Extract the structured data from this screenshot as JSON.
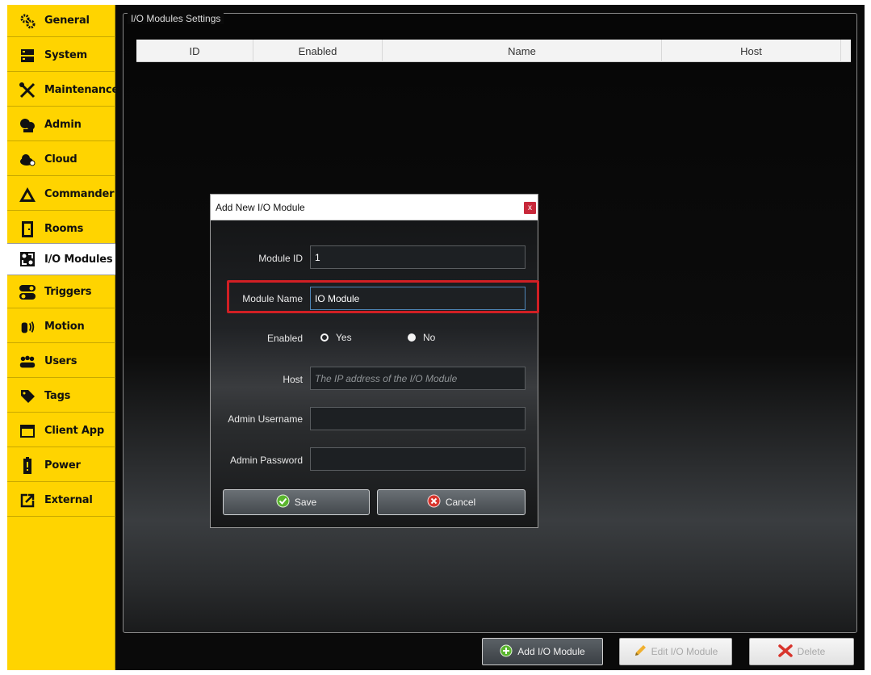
{
  "sidebar": {
    "items": [
      {
        "label": "General",
        "icon": "gears-icon"
      },
      {
        "label": "System",
        "icon": "server-icon"
      },
      {
        "label": "Maintenance",
        "icon": "tools-icon"
      },
      {
        "label": "Admin",
        "icon": "admin-icon"
      },
      {
        "label": "Cloud",
        "icon": "cloud-icon"
      },
      {
        "label": "Commander",
        "icon": "commander-icon"
      },
      {
        "label": "Rooms",
        "icon": "door-icon"
      },
      {
        "label": "I/O Modules",
        "icon": "io-module-icon",
        "active": true
      },
      {
        "label": "Triggers",
        "icon": "toggle-icon"
      },
      {
        "label": "Motion",
        "icon": "motion-hand-icon"
      },
      {
        "label": "Users",
        "icon": "users-icon"
      },
      {
        "label": "Tags",
        "icon": "tag-icon"
      },
      {
        "label": "Client App",
        "icon": "window-icon"
      },
      {
        "label": "Power",
        "icon": "battery-icon"
      },
      {
        "label": "External",
        "icon": "external-link-icon"
      }
    ]
  },
  "main": {
    "group_title": "I/O Modules Settings",
    "columns": [
      "ID",
      "Enabled",
      "Name",
      "Host"
    ],
    "toolbar": {
      "add_label": "Add I/O Module",
      "edit_label": "Edit I/O Module",
      "delete_label": "Delete"
    }
  },
  "dialog": {
    "title": "Add New I/O Module",
    "close_label": "x",
    "module_id_label": "Module ID",
    "module_id_value": "1",
    "module_name_label": "Module Name",
    "module_name_value": "IO Module",
    "enabled_label": "Enabled",
    "enabled_yes": "Yes",
    "enabled_no": "No",
    "host_label": "Host",
    "host_placeholder": "The IP address of the I/O Module",
    "admin_username_label": "Admin Username",
    "admin_password_label": "Admin Password",
    "save_label": "Save",
    "cancel_label": "Cancel"
  },
  "colors": {
    "sidebar_bg": "#ffd400",
    "highlight": "#d11f24",
    "save_check": "#5ab52e",
    "cancel_x": "#d8342c"
  }
}
